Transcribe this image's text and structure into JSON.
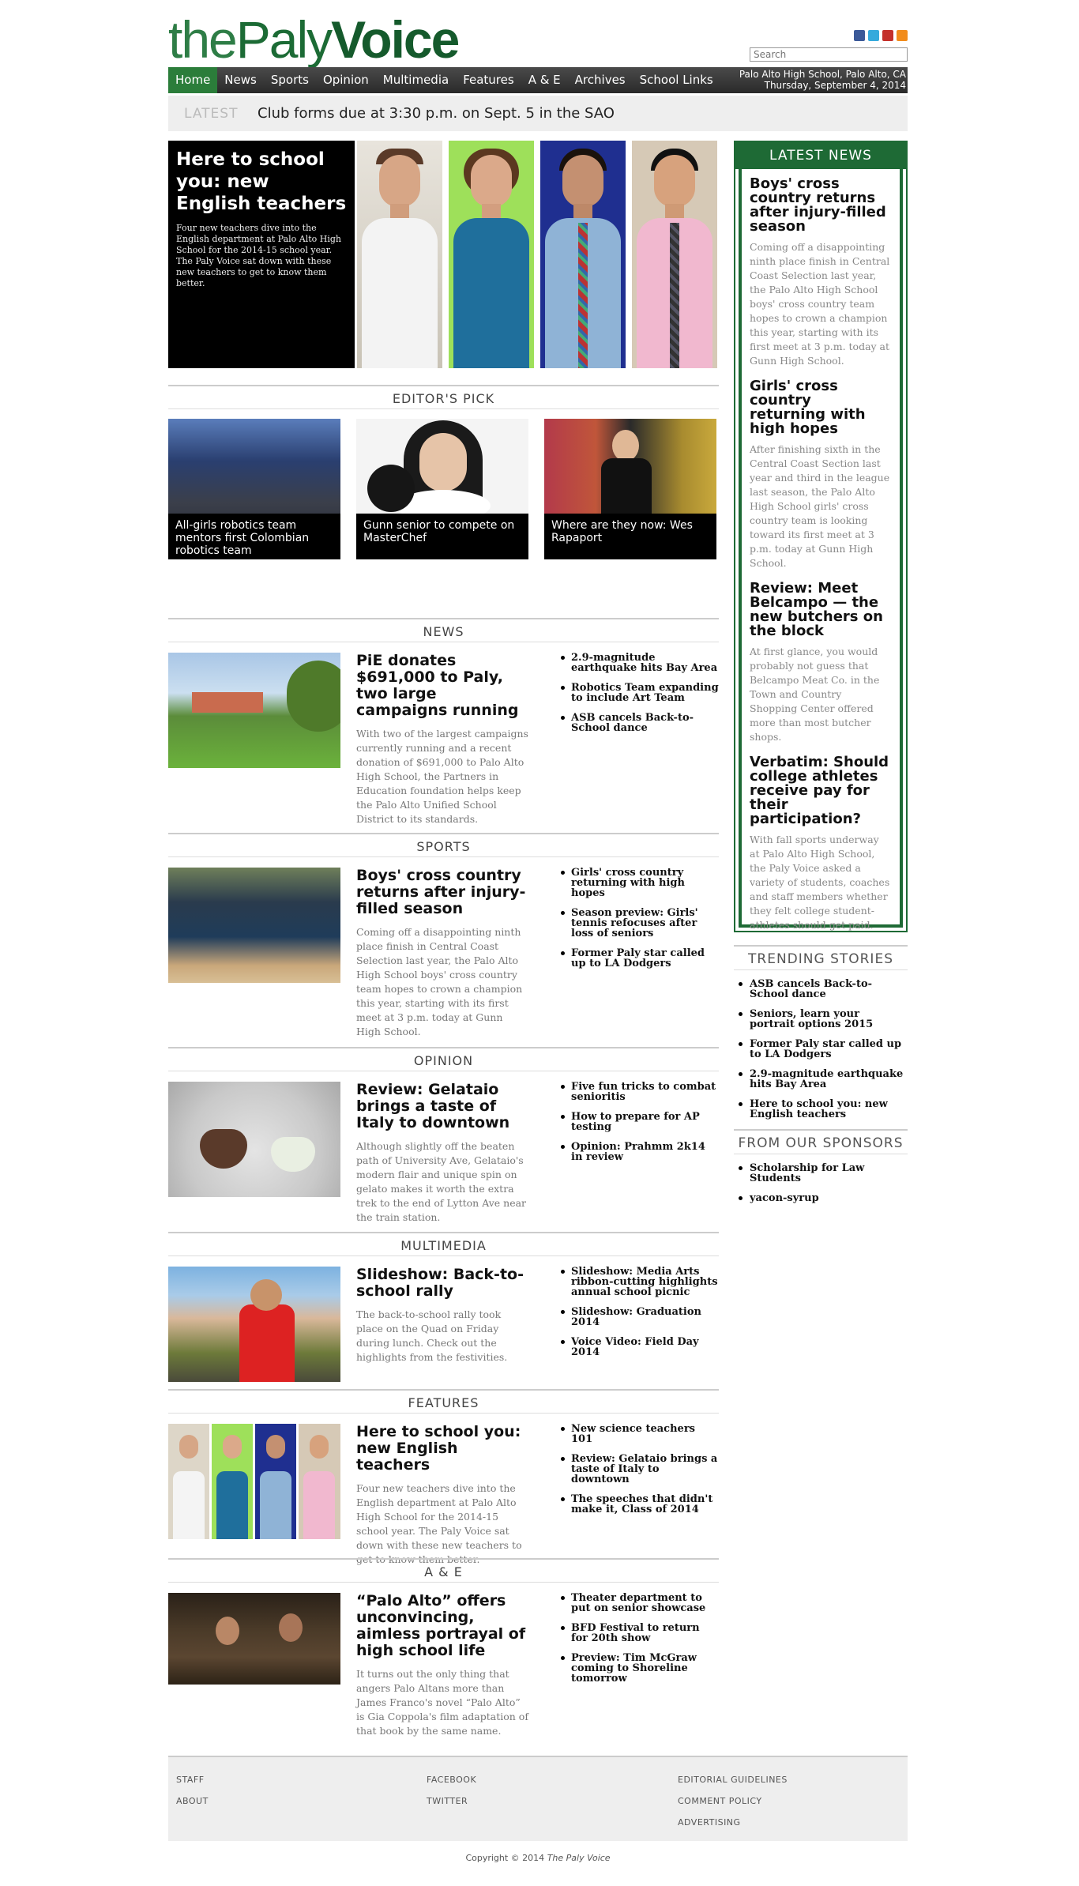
{
  "brand": {
    "part1": "the",
    "part2": "Paly",
    "part3": "Voice"
  },
  "search": {
    "placeholder": "Search"
  },
  "nav": {
    "items": [
      "Home",
      "News",
      "Sports",
      "Opinion",
      "Multimedia",
      "Features",
      "A & E",
      "Archives",
      "School Links"
    ],
    "location": "Palo Alto High School, Palo Alto, CA",
    "date": "Thursday, September 4, 2014"
  },
  "ticker": {
    "label": "LATEST",
    "text": "Club forms due at 3:30 p.m. on Sept. 5 in the SAO"
  },
  "hero": {
    "title": "Here to school you: new English teachers",
    "summary": "Four new teachers dive into the English department at Palo Alto High School for the 2014-15 school year. The Paly Voice sat down with these new teachers to get to know them better."
  },
  "editors_pick": {
    "heading": "EDITOR'S PICK",
    "items": [
      "All-girls robotics team mentors first Colombian robotics team",
      "Gunn senior to compete on MasterChef",
      "Where are they now: Wes Rapaport"
    ]
  },
  "news": {
    "heading": "NEWS",
    "title": "PiE donates $691,000 to Paly, two large campaigns running",
    "summary": "With two of the largest campaigns currently running and a recent donation of $691,000 to Palo Alto High School, the Partners in Education foundation helps keep the Palo Alto Unified School District to its standards.",
    "links": [
      "2.9-magnitude earthquake hits Bay Area",
      "Robotics Team expanding to include Art Team",
      "ASB cancels Back-to-School dance"
    ]
  },
  "sports": {
    "heading": "SPORTS",
    "title": "Boys' cross country returns after injury-filled season",
    "summary": "Coming off a disappointing ninth place finish in Central Coast Selection last year, the Palo Alto High School boys' cross country team hopes to crown a champion this year, starting with its first meet at 3 p.m. today at Gunn High School.",
    "links": [
      "Girls' cross country returning with high hopes",
      "Season preview: Girls' tennis refocuses after loss of seniors",
      "Former Paly star called up to LA Dodgers"
    ]
  },
  "opinion": {
    "heading": "OPINION",
    "title": "Review: Gelataio brings a taste of Italy to downtown",
    "summary": "Although slightly off the beaten path of University Ave, Gelataio's modern flair and unique spin on gelato makes it worth the extra trek to the end of Lytton Ave near the train station.",
    "links": [
      "Five fun tricks to combat senioritis",
      "How to prepare for AP testing",
      "Opinion: Prahmm 2k14 in review"
    ]
  },
  "multimedia": {
    "heading": "MULTIMEDIA",
    "title": "Slideshow: Back-to-school rally",
    "summary": "The back-to-school rally took place on the Quad on Friday during lunch. Check out the highlights from the festivities.",
    "links": [
      "Slideshow: Media Arts ribbon-cutting highlights annual school picnic",
      "Slideshow: Graduation 2014",
      "Voice Video: Field Day 2014"
    ]
  },
  "features": {
    "heading": "FEATURES",
    "title": "Here to school you: new English teachers",
    "summary": "Four new teachers dive into the English department at Palo Alto High School for the 2014-15 school year. The Paly Voice sat down with these new teachers to get to know them better.",
    "links": [
      "New science teachers 101",
      "Review: Gelataio brings a taste of Italy to downtown",
      "The speeches that didn't make it, Class of 2014"
    ]
  },
  "ae": {
    "heading": "A & E",
    "title": "“Palo Alto” offers unconvincing, aimless portrayal of high school life",
    "summary": "It turns out the only thing that angers Palo Altans more than James Franco's novel “Palo Alto” is Gia Coppola's film adaptation of that book by the same name.",
    "links": [
      "Theater department to put on senior showcase",
      "BFD Festival to return for 20th show",
      "Preview: Tim McGraw coming to Shoreline tomorrow"
    ]
  },
  "latest_news": {
    "heading": "LATEST NEWS",
    "items": [
      {
        "title": "Boys' cross country returns after injury-filled season",
        "summary": "Coming off a disappointing ninth place finish in Central Coast Selection last year, the Palo Alto High School boys' cross country team hopes to crown a champion this year, starting with its first meet at 3 p.m. today at Gunn High School."
      },
      {
        "title": "Girls' cross country returning with high hopes",
        "summary": "After finishing sixth in the Central Coast Section last year and third in the league last season, the Palo Alto High School girls' cross country team is looking toward its first meet at 3 p.m. today at Gunn High School."
      },
      {
        "title": "Review: Meet Belcampo — the new butchers on the block",
        "summary": "At first glance, you would probably not guess that Belcampo Meat Co. in the Town and Country Shopping Center offered more than most butcher shops."
      },
      {
        "title": "Verbatim: Should college athletes receive pay for their participation?",
        "summary": "With fall sports underway at Palo Alto High School, the Paly Voice asked a variety of students, coaches and staff members whether they felt college student-athletes should get paid."
      }
    ]
  },
  "trending": {
    "heading": "TRENDING STORIES",
    "items": [
      "ASB cancels Back-to-School dance",
      "Seniors, learn your portrait options 2015",
      "Former Paly star called up to LA Dodgers",
      "2.9-magnitude earthquake hits Bay Area",
      "Here to school you: new English teachers"
    ]
  },
  "sponsors": {
    "heading": "FROM OUR SPONSORS",
    "items": [
      "Scholarship for Law Students",
      "yacon-syrup"
    ]
  },
  "footer": {
    "links": [
      "STAFF",
      "ABOUT",
      "FACEBOOK",
      "TWITTER",
      "EDITORIAL GUIDELINES",
      "COMMENT POLICY",
      "ADVERTISING"
    ],
    "copyright": "Copyright © 2014",
    "publication": "The Paly Voice"
  },
  "colors": {
    "brand_green": "#1e6a35",
    "nav_active": "#2b7d3a"
  }
}
